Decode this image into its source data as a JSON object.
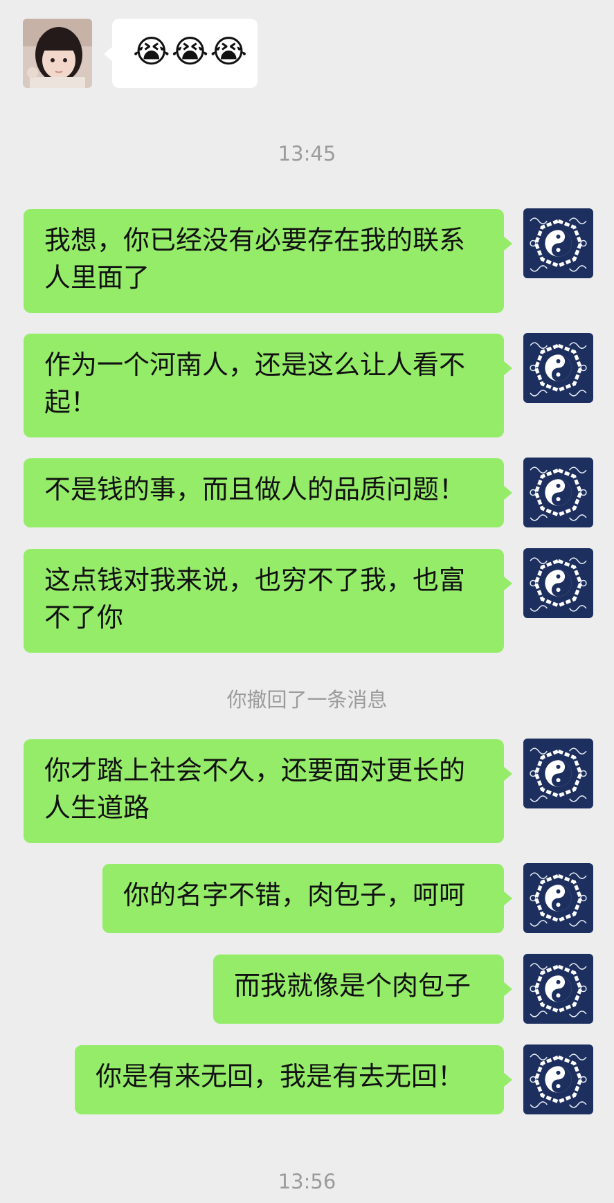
{
  "messages": {
    "incoming_emoji": "😭😭😭",
    "time_1": "13:45",
    "m1": "我想，你已经没有必要存在我的联系人里面了",
    "m2": "作为一个河南人，还是这么让人看不起！",
    "m3": "不是钱的事，而且做人的品质问题！",
    "m4": "这点钱对我来说，也穷不了我，也富不了你",
    "recall_notice": "你撤回了一条消息",
    "m5": "你才踏上社会不久，还要面对更长的人生道路",
    "m6": "你的名字不错，肉包子，呵呵",
    "m7": "而我就像是个肉包子",
    "m8": "你是有来无回，我是有去无回！",
    "time_2": "13:56"
  },
  "colors": {
    "background": "#ededed",
    "outgoing_bubble": "#95ec69",
    "incoming_bubble": "#ffffff",
    "system_text": "#9b9b9b",
    "my_avatar_bg": "#1c2f5e"
  },
  "icons": {
    "contact_avatar": "girl-photo-avatar",
    "my_avatar": "bagua-yin-yang-avatar"
  }
}
